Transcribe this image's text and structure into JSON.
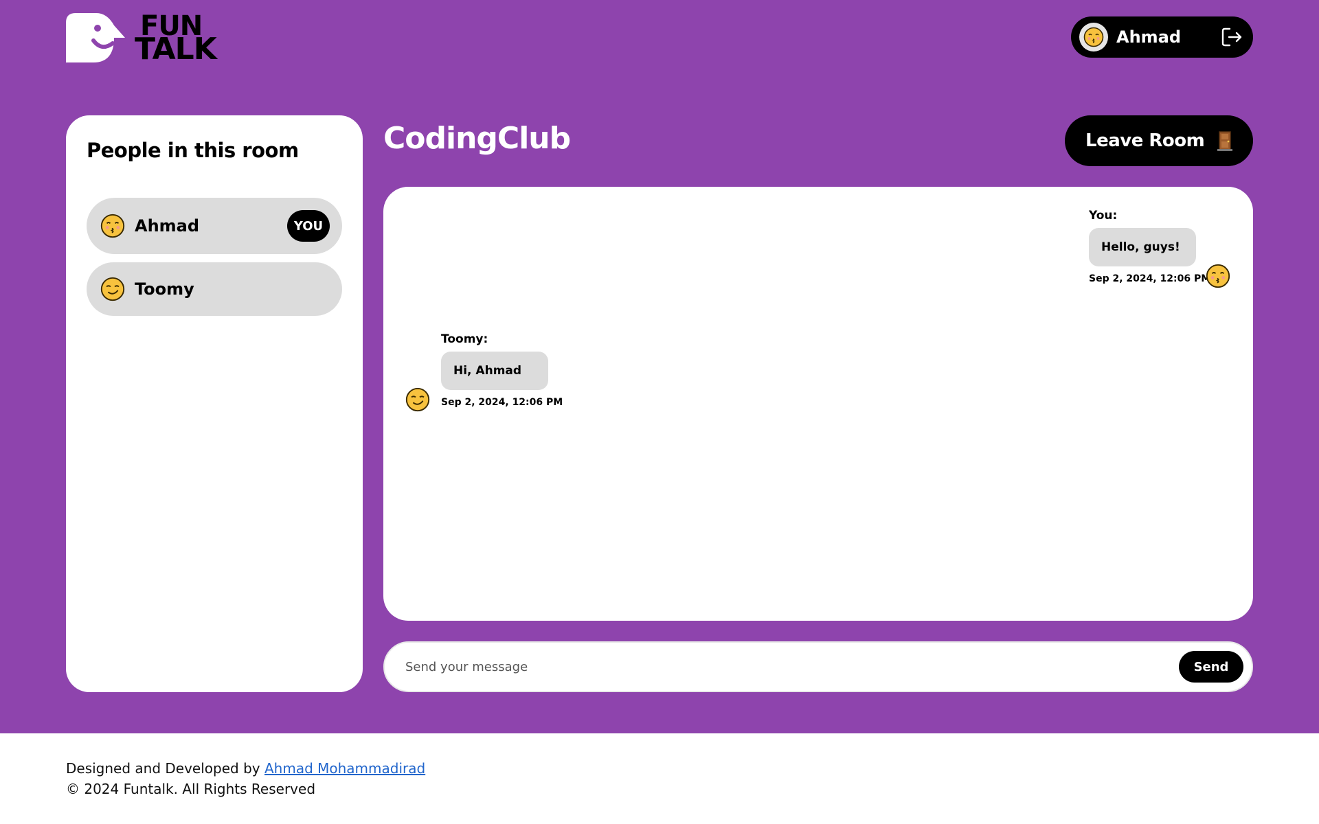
{
  "brand": {
    "line1": "FUN",
    "line2": "TALK"
  },
  "header": {
    "user_name": "Ahmad",
    "logout_icon": "logout-icon"
  },
  "people_panel": {
    "title": "People in this room",
    "members": [
      {
        "name": "Ahmad",
        "badge": "YOU",
        "emoji": "kissing-smiling-eyes-icon"
      },
      {
        "name": "Toomy",
        "emoji": "smirk-face-icon"
      }
    ]
  },
  "room": {
    "title": "CodingClub",
    "leave_label": "Leave Room",
    "leave_icon": "door-icon"
  },
  "messages": [
    {
      "sender": "You:",
      "text": "Hello, guys!",
      "time": "Sep 2, 2024, 12:06 PM",
      "side": "right"
    },
    {
      "sender": "Toomy:",
      "text": "Hi, Ahmad",
      "time": "Sep 2, 2024, 12:06 PM",
      "side": "left"
    }
  ],
  "composer": {
    "placeholder": "Send your message",
    "value": "",
    "send_label": "Send"
  },
  "footer": {
    "credit_prefix": "Designed and Developed by",
    "credit_link": "Ahmad Mohammadirad",
    "copyright": "© 2024 Funtalk. All Rights Reserved"
  },
  "colors": {
    "primary": "#8e44ad",
    "dark": "#000000",
    "bubble": "#dcdcdc",
    "link": "#2266cc"
  }
}
